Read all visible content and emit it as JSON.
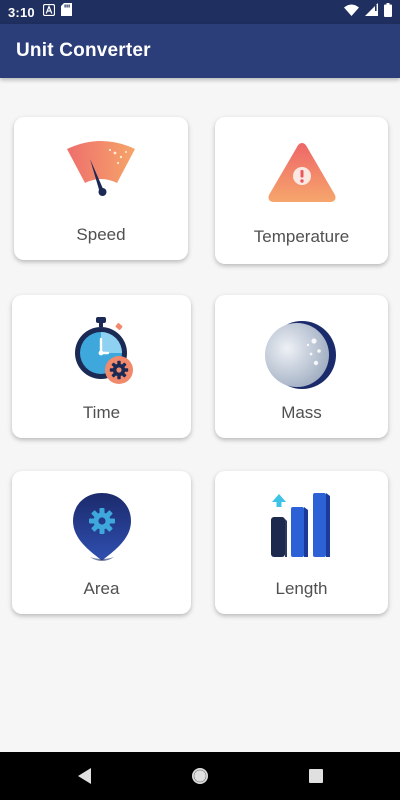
{
  "status_bar": {
    "time": "3:10",
    "icons": [
      "a-notification-icon",
      "sd-card-icon",
      "wifi-icon",
      "signal-icon",
      "battery-icon"
    ]
  },
  "app_bar": {
    "title": "Unit Converter",
    "color": "#2b3e7a"
  },
  "categories": [
    {
      "label": "Speed",
      "icon": "speedometer-icon"
    },
    {
      "label": "Temperature",
      "icon": "warning-triangle-icon"
    },
    {
      "label": "Time",
      "icon": "stopwatch-icon"
    },
    {
      "label": "Mass",
      "icon": "moon-icon"
    },
    {
      "label": "Area",
      "icon": "map-pin-gear-icon"
    },
    {
      "label": "Length",
      "icon": "bar-growth-icon"
    }
  ],
  "nav_bar": {
    "buttons": [
      "back-icon",
      "home-icon",
      "recents-icon"
    ]
  }
}
